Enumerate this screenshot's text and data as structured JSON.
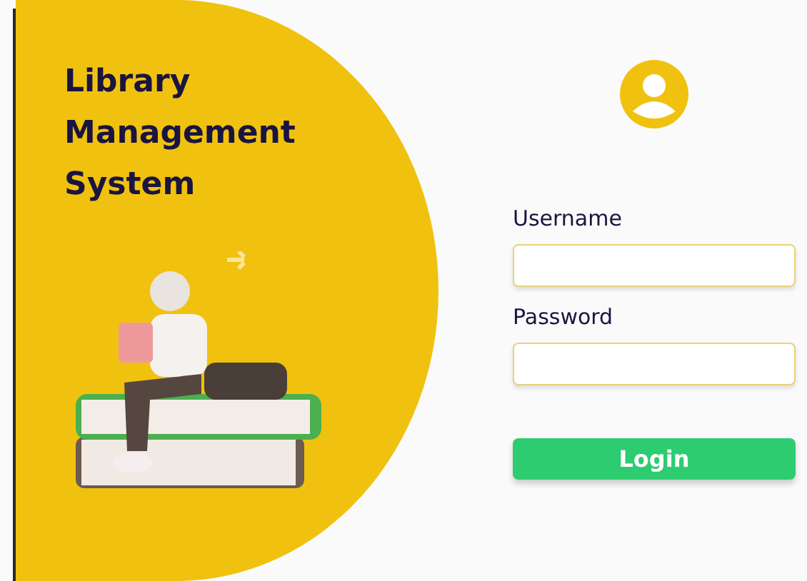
{
  "hero": {
    "title": "Library Management System"
  },
  "form": {
    "fields": [
      {
        "label": "Username"
      },
      {
        "label": "Password"
      }
    ],
    "button": "Login"
  }
}
